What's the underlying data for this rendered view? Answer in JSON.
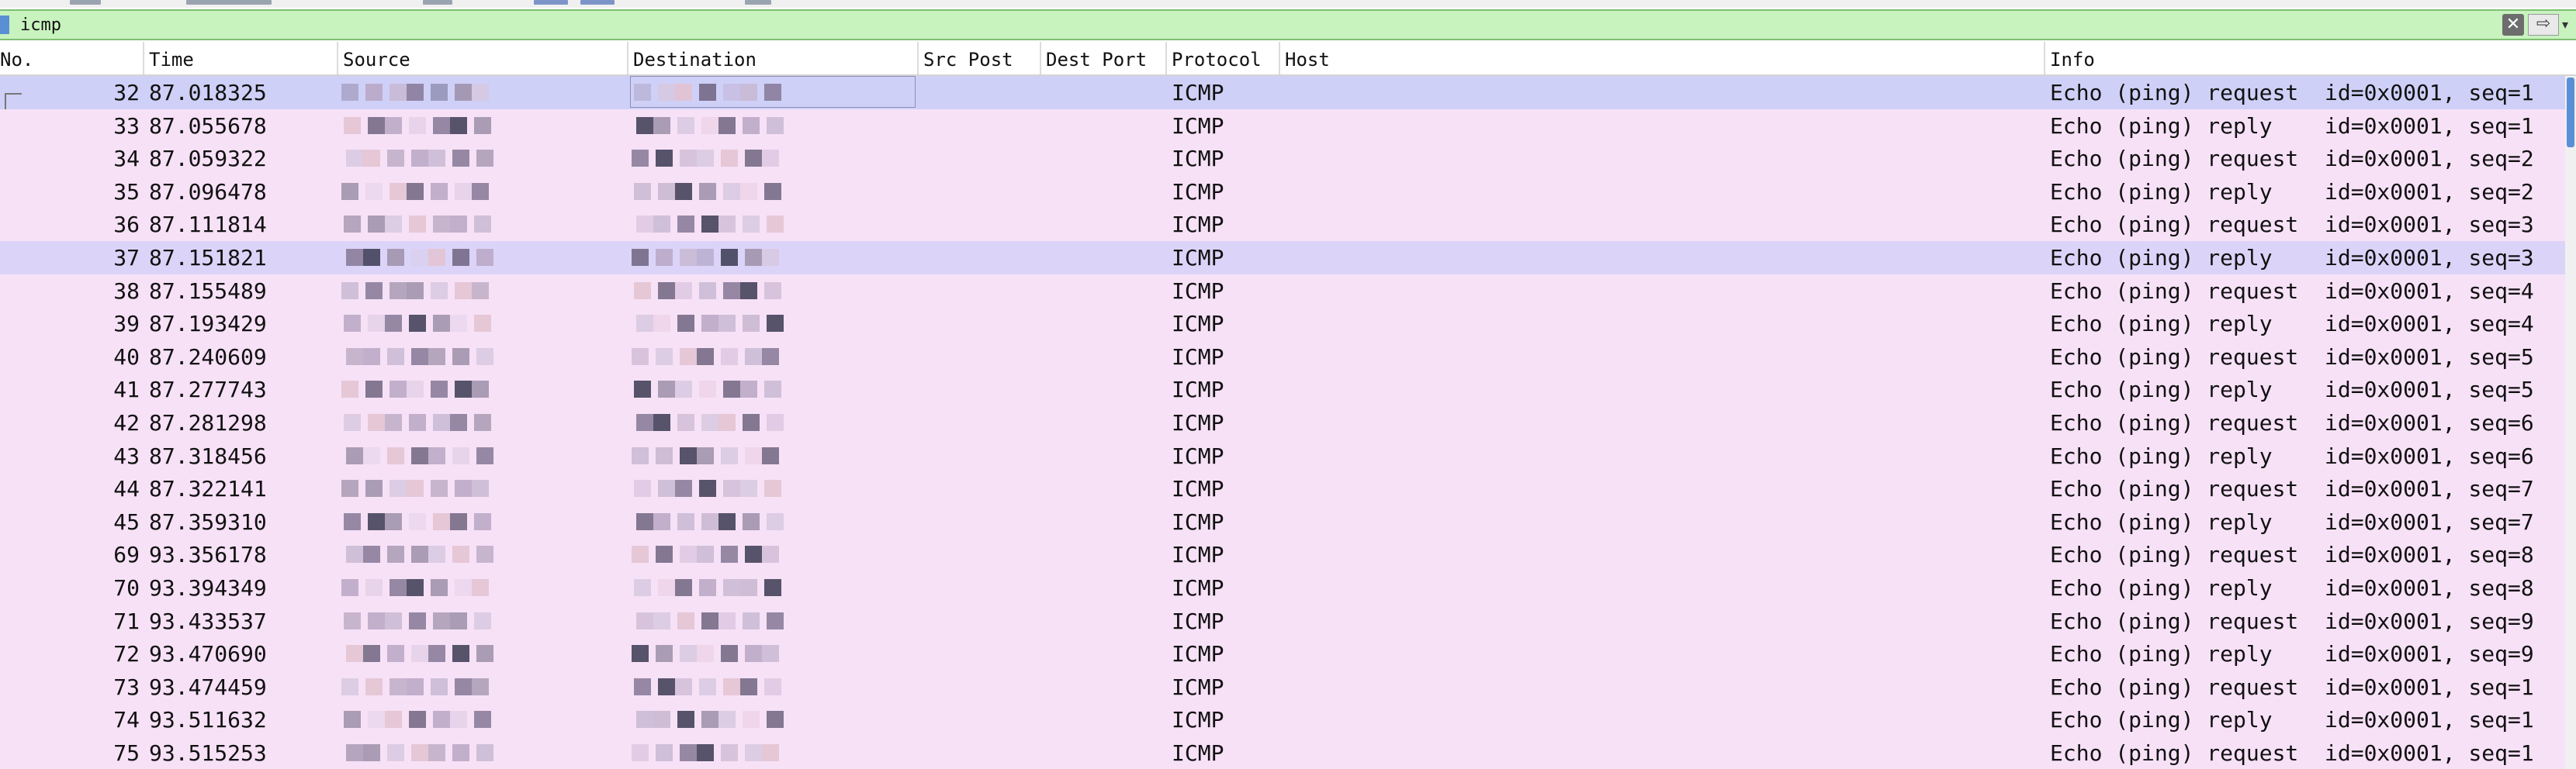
{
  "filter": {
    "value": "icmp"
  },
  "columns": {
    "no": "No.",
    "time": "Time",
    "source": "Source",
    "destination": "Destination",
    "src_port": "Src Post",
    "dest_port": "Dest Port",
    "protocol": "Protocol",
    "host": "Host",
    "info": "Info"
  },
  "packets": [
    {
      "no": "32",
      "time": "87.018325",
      "protocol": "ICMP",
      "info": "Echo (ping) request  id=0x0001, seq=1"
    },
    {
      "no": "33",
      "time": "87.055678",
      "protocol": "ICMP",
      "info": "Echo (ping) reply    id=0x0001, seq=1"
    },
    {
      "no": "34",
      "time": "87.059322",
      "protocol": "ICMP",
      "info": "Echo (ping) request  id=0x0001, seq=2"
    },
    {
      "no": "35",
      "time": "87.096478",
      "protocol": "ICMP",
      "info": "Echo (ping) reply    id=0x0001, seq=2"
    },
    {
      "no": "36",
      "time": "87.111814",
      "protocol": "ICMP",
      "info": "Echo (ping) request  id=0x0001, seq=3"
    },
    {
      "no": "37",
      "time": "87.151821",
      "protocol": "ICMP",
      "info": "Echo (ping) reply    id=0x0001, seq=3"
    },
    {
      "no": "38",
      "time": "87.155489",
      "protocol": "ICMP",
      "info": "Echo (ping) request  id=0x0001, seq=4"
    },
    {
      "no": "39",
      "time": "87.193429",
      "protocol": "ICMP",
      "info": "Echo (ping) reply    id=0x0001, seq=4"
    },
    {
      "no": "40",
      "time": "87.240609",
      "protocol": "ICMP",
      "info": "Echo (ping) request  id=0x0001, seq=5"
    },
    {
      "no": "41",
      "time": "87.277743",
      "protocol": "ICMP",
      "info": "Echo (ping) reply    id=0x0001, seq=5"
    },
    {
      "no": "42",
      "time": "87.281298",
      "protocol": "ICMP",
      "info": "Echo (ping) request  id=0x0001, seq=6"
    },
    {
      "no": "43",
      "time": "87.318456",
      "protocol": "ICMP",
      "info": "Echo (ping) reply    id=0x0001, seq=6"
    },
    {
      "no": "44",
      "time": "87.322141",
      "protocol": "ICMP",
      "info": "Echo (ping) request  id=0x0001, seq=7"
    },
    {
      "no": "45",
      "time": "87.359310",
      "protocol": "ICMP",
      "info": "Echo (ping) reply    id=0x0001, seq=7"
    },
    {
      "no": "69",
      "time": "93.356178",
      "protocol": "ICMP",
      "info": "Echo (ping) request  id=0x0001, seq=8"
    },
    {
      "no": "70",
      "time": "93.394349",
      "protocol": "ICMP",
      "info": "Echo (ping) reply    id=0x0001, seq=8"
    },
    {
      "no": "71",
      "time": "93.433537",
      "protocol": "ICMP",
      "info": "Echo (ping) request  id=0x0001, seq=9"
    },
    {
      "no": "72",
      "time": "93.470690",
      "protocol": "ICMP",
      "info": "Echo (ping) reply    id=0x0001, seq=9"
    },
    {
      "no": "73",
      "time": "93.474459",
      "protocol": "ICMP",
      "info": "Echo (ping) request  id=0x0001, seq=1"
    },
    {
      "no": "74",
      "time": "93.511632",
      "protocol": "ICMP",
      "info": "Echo (ping) reply    id=0x0001, seq=1"
    },
    {
      "no": "75",
      "time": "93.515253",
      "protocol": "ICMP",
      "info": "Echo (ping) request  id=0x0001, seq=1"
    }
  ],
  "colors": {
    "row": "#f7e1f7",
    "selected_row": "#cfd0f7",
    "filter_valid": "#c8f3bf"
  }
}
